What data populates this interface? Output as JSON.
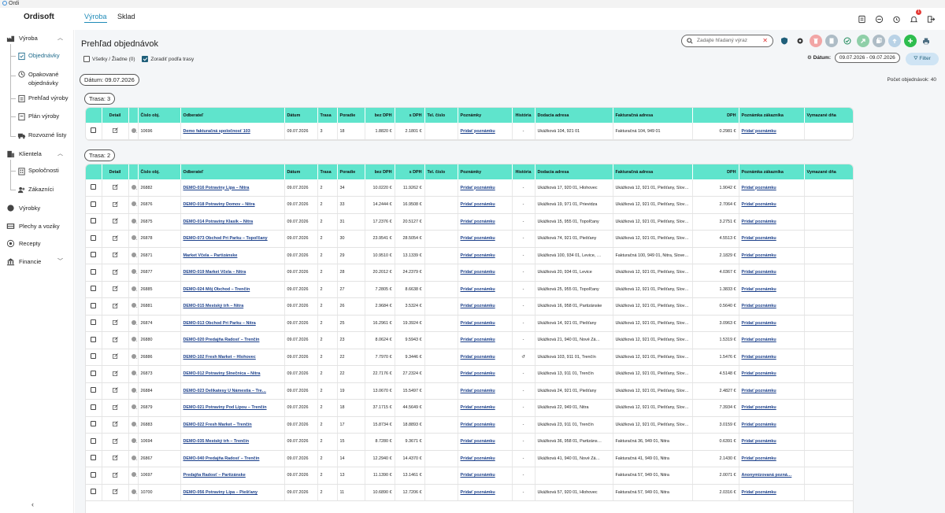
{
  "window": {
    "title": "Ordi"
  },
  "app": {
    "brand": "Ordisoft"
  },
  "topnav": [
    {
      "label": "Výroba",
      "active": true
    },
    {
      "label": "Sklad",
      "active": false
    }
  ],
  "topicons": {
    "notification_count": "1"
  },
  "sidebar": {
    "vyroba": "Výroba",
    "objednavky": "Objednávky",
    "opakovane": "Opakované objednávky",
    "prehlad": "Prehľad výroby",
    "plan": "Plán výroby",
    "rozvozne": "Rozvozné listy",
    "klientela": "Klientela",
    "spolocnosti": "Spoločnosti",
    "zakaznici": "Zákazníci",
    "vyrobky": "Výrobky",
    "plechy": "Plechy a voziky",
    "recepty": "Recepty",
    "financie": "Financie",
    "collapse": "‹"
  },
  "page": {
    "title": "Prehľad objednávok",
    "all_none_label": "Všetky / Žiadne (0)",
    "sort_label": "Zoradiť podľa trasy",
    "search_placeholder": "Zadajte hľadaný výraz",
    "date_label": "Dátum:",
    "date_value": "09.07.2026 - 09.07.2026",
    "filter_label": "Filter",
    "group_date": "Dátum: 09.07.2026",
    "order_count": "Počet objednávok: 40"
  },
  "columns": [
    "",
    "Detail",
    "",
    "Číslo obj.",
    "Odberateľ",
    "Dátum",
    "Trasa",
    "Poradie",
    "bez DPH",
    "s DPH",
    "Tel. číslo",
    "Poznámky",
    "História",
    "Dodacia adresa",
    "Fakturačná adresa",
    "DPH",
    "Poznámka zákazníka",
    "Vymazané dňa"
  ],
  "groups": [
    {
      "label": "Trasa: 3",
      "rows": [
        [
          "10696",
          "Demo fakturačná spoločnosť 103",
          "09.07.2026",
          "3",
          "18",
          "1.8820 €",
          "2.1801 €",
          "",
          "Pridať poznámku",
          "-",
          "Ukážková 104, 921 01",
          "Fakturačná 104, 949 01",
          "0.2981 €",
          "Pridať poznámku",
          ""
        ]
      ]
    },
    {
      "label": "Trasa: 2",
      "rows": [
        [
          "26882",
          "DEMO-016 Potraviny Lipa – Nitra",
          "09.07.2026",
          "2",
          "34",
          "10.0220 €",
          "11.9262 €",
          "",
          "Pridať poznámku",
          "-",
          "Ukážková 17, 920 01, Hlohovec",
          "Ukážková 12, 921 01, Piešťany, Slov…",
          "1.9042 €",
          "Pridať poznámku",
          ""
        ],
        [
          "26876",
          "DEMO-018 Potraviny Domov – Nitra",
          "09.07.2026",
          "2",
          "33",
          "14.2444 €",
          "16.9508 €",
          "",
          "Pridať poznámku",
          "-",
          "Ukážková 19, 971 01, Prievidza",
          "Ukážková 12, 921 01, Piešťany, Slov…",
          "2.7064 €",
          "Pridať poznámku",
          ""
        ],
        [
          "26875",
          "DEMO-014 Potraviny Klasik – Nitra",
          "09.07.2026",
          "2",
          "31",
          "17.2376 €",
          "20.5127 €",
          "",
          "Pridať poznámku",
          "-",
          "Ukážková 15, 955 01, Topoľčany",
          "Ukážková 12, 921 01, Piešťany, Slov…",
          "3.2751 €",
          "Pridať poznámku",
          ""
        ],
        [
          "26878",
          "DEMO-073 Obchod Pri Parku – Topoľčany",
          "09.07.2026",
          "2",
          "30",
          "23.9541 €",
          "28.5054 €",
          "",
          "Pridať poznámku",
          "-",
          "Ukážková 74, 921 01, Piešťany",
          "Ukážková 12, 921 01, Piešťany, Slov…",
          "4.5513 €",
          "Pridať poznámku",
          ""
        ],
        [
          "26871",
          "Market Včela – Partizánske",
          "09.07.2026",
          "2",
          "29",
          "10.9510 €",
          "13.1339 €",
          "",
          "Pridať poznámku",
          "-",
          "Ukážková 100, 934 01, Levice, …",
          "Fakturačná 100, 949 01, Nitra, Slove…",
          "2.1829 €",
          "Pridať poznámku",
          ""
        ],
        [
          "26877",
          "DEMO-019 Market Včela – Nitra",
          "09.07.2026",
          "2",
          "28",
          "20.2012 €",
          "24.2379 €",
          "",
          "Pridať poznámku",
          "-",
          "Ukážková 20, 934 01, Levice",
          "Ukážková 12, 921 01, Piešťany, Slov…",
          "4.0367 €",
          "Pridať poznámku",
          ""
        ],
        [
          "26885",
          "DEMO-024 Môj Obchod – Trenčín",
          "09.07.2026",
          "2",
          "27",
          "7.2805 €",
          "8.6638 €",
          "",
          "Pridať poznámku",
          "-",
          "Ukážková 25, 955 01, Topoľčany",
          "Ukážková 12, 921 01, Piešťany, Slov…",
          "1.3833 €",
          "Pridať poznámku",
          ""
        ],
        [
          "26881",
          "DEMO-015 Mestský trh – Nitra",
          "09.07.2026",
          "2",
          "26",
          "2.9684 €",
          "3.5324 €",
          "",
          "Pridať poznámku",
          "-",
          "Ukážková 16, 958 01, Partizánske",
          "Ukážková 12, 921 01, Piešťany, Slov…",
          "0.5640 €",
          "Pridať poznámku",
          ""
        ],
        [
          "26874",
          "DEMO-013 Obchod Pri Parku – Nitra",
          "09.07.2026",
          "2",
          "25",
          "16.2961 €",
          "19.3924 €",
          "",
          "Pridať poznámku",
          "-",
          "Ukážková 14, 921 01, Piešťany",
          "Ukážková 12, 921 01, Piešťany, Slov…",
          "3.0963 €",
          "Pridať poznámku",
          ""
        ],
        [
          "26880",
          "DEMO-020 Predajňa Radosť – Trenčín",
          "09.07.2026",
          "2",
          "23",
          "8.0624 €",
          "9.5943 €",
          "",
          "Pridať poznámku",
          "-",
          "Ukážková 21, 940 01, Nové Zá…",
          "Ukážková 12, 921 01, Piešťany, Slov…",
          "1.5319 €",
          "Pridať poznámku",
          ""
        ],
        [
          "26886",
          "DEMO-102 Fresh Market – Hlohovec",
          "09.07.2026",
          "2",
          "22",
          "7.7970 €",
          "9.3446 €",
          "",
          "Pridať poznámku",
          "↺",
          "Ukážková 103, 911 01, Trenčín",
          "Ukážková 12, 921 01, Piešťany, Slov…",
          "1.5476 €",
          "Pridať poznámku",
          ""
        ],
        [
          "26873",
          "DEMO-012 Potraviny Slnečnica – Nitra",
          "09.07.2026",
          "2",
          "22",
          "22.7176 €",
          "27.2324 €",
          "",
          "Pridať poznámku",
          "-",
          "Ukážková 13, 911 01, Trenčín",
          "Ukážková 12, 921 01, Piešťany, Slov…",
          "4.5148 €",
          "Pridať poznámku",
          ""
        ],
        [
          "26884",
          "DEMO-023 Delikatesy U Námestia – Tre…",
          "09.07.2026",
          "2",
          "19",
          "13.0670 €",
          "15.5497 €",
          "",
          "Pridať poznámku",
          "-",
          "Ukážková 24, 921 01, Piešťany",
          "Ukážková 12, 921 01, Piešťany, Slov…",
          "2.4827 €",
          "Pridať poznámku",
          ""
        ],
        [
          "26879",
          "DEMO-021 Potraviny Pod Lipou – Trenčín",
          "09.07.2026",
          "2",
          "18",
          "37.1715 €",
          "44.5649 €",
          "",
          "Pridať poznámku",
          "-",
          "Ukážková 22, 949 01, Nitra",
          "Ukážková 12, 921 01, Piešťany, Slov…",
          "7.3934 €",
          "Pridať poznámku",
          ""
        ],
        [
          "26883",
          "DEMO-022 Fresh Market – Trenčín",
          "09.07.2026",
          "2",
          "17",
          "15.8734 €",
          "18.8893 €",
          "",
          "Pridať poznámku",
          "-",
          "Ukážková 23, 911 01, Trenčín",
          "Ukážková 12, 921 01, Piešťany, Slov…",
          "3.0159 €",
          "Pridať poznámku",
          ""
        ],
        [
          "10694",
          "DEMO-035 Mestský trh – Trenčín",
          "09.07.2026",
          "2",
          "15",
          "8.7280 €",
          "9.3671 €",
          "",
          "Pridať poznámku",
          "-",
          "Ukážková 36, 958 01, Partizáns…",
          "Fakturačná 36, 949 01, Nitra",
          "0.6391 €",
          "Pridať poznámku",
          ""
        ],
        [
          "26867",
          "DEMO-040 Predajňa Radosť – Trenčín",
          "09.07.2026",
          "2",
          "14",
          "12.2940 €",
          "14.4370 €",
          "",
          "Pridať poznámku",
          "-",
          "Ukážková 41, 940 01, Nové Zá…",
          "Fakturačná 41, 949 01, Nitra",
          "2.1430 €",
          "Pridať poznámku",
          ""
        ],
        [
          "10697",
          "Predajňa Radosť – Partizánske",
          "09.07.2026",
          "2",
          "13",
          "11.1390 €",
          "13.1461 €",
          "",
          "Pridať poznámku",
          "-",
          "",
          "Fakturačná 57, 949 01, Nitra",
          "2.0071 €",
          "Anonymizovaná pozná…",
          ""
        ],
        [
          "10700",
          "DEMO-056 Potraviny Lipa – Piešťany",
          "09.07.2026",
          "2",
          "11",
          "10.6890 €",
          "12.7206 €",
          "",
          "Pridať poznámku",
          "-",
          "Ukážková 57, 920 01, Hlohovec",
          "Fakturačná 57, 949 01, Nitra",
          "2.0316 €",
          "Pridať poznámku",
          ""
        ]
      ]
    }
  ],
  "colors": {
    "header": "#5fe4cc",
    "accent": "#1f8bb8"
  }
}
